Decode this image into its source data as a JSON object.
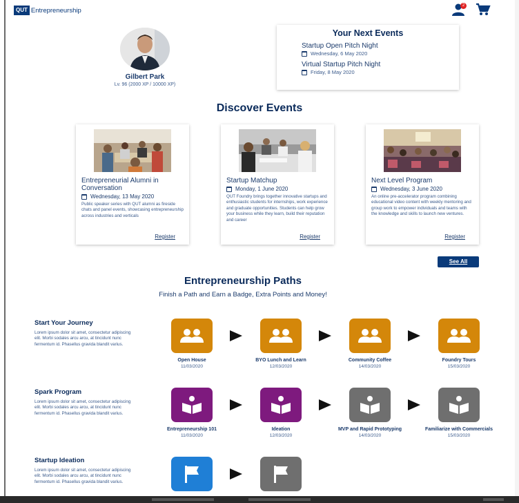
{
  "header": {
    "logo_mark": "QUT",
    "logo_text": "Entrepreneurship",
    "notification_count": "2"
  },
  "profile": {
    "name": "Gilbert Park",
    "level": "Lv. 96 (2000 XP / 10000 XP)"
  },
  "next_events": {
    "title": "Your Next Events",
    "items": [
      {
        "title": "Startup Open Pitch Night",
        "date": "Wednesday, 6 May 2020"
      },
      {
        "title": "Virtual Startup Pitch Night",
        "date": "Friday, 8 May 2020"
      }
    ]
  },
  "discover": {
    "title": "Discover Events",
    "see_all": "See All",
    "cards": [
      {
        "title": "Entrepreneurial Alumni in Conversation",
        "date": "Wednesday, 13 May 2020",
        "desc": "Public speaker series with QUT alumni as fireside chats and panel events, showcasing entrepreneurship across industries and verticals",
        "register": "Register"
      },
      {
        "title": "Startup Matchup",
        "date": "Monday, 1 June 2020",
        "desc": "QUT Foundry brings together innovative startups and enthusiastic students for internships, work experience and graduate opportunities. Students can help grow your business while they learn, build their reputation and career",
        "register": "Register"
      },
      {
        "title": "Next Level Program",
        "date": "Wednesday, 3 June 2020",
        "desc": "An online pre-accelerator program combining educational video content with weekly mentoring and group work to empower individuals and teams with the knowledge and skills to launch new ventures.",
        "register": "Register"
      }
    ]
  },
  "paths": {
    "title": "Entrepreneurship Paths",
    "subtitle": "Finish a Path and Earn a Badge, Extra Points and Money!",
    "rows": [
      {
        "title": "Start Your Journey",
        "desc": "Lorem ipsum dolor sit amet, consectetur adipiscing elit. Morbi sodales arcu arcu, at tincidunt nunc fermentum id. Phasellus gravida blandit varius.",
        "steps": [
          {
            "label": "Open House",
            "date": "11/03/2020",
            "icon": "group-icon",
            "color": "#d4870a"
          },
          {
            "label": "BYO Lunch and Learn",
            "date": "12/03/2020",
            "icon": "group-icon",
            "color": "#d4870a"
          },
          {
            "label": "Community Coffee",
            "date": "14/03/2020",
            "icon": "group-icon",
            "color": "#d4870a"
          },
          {
            "label": "Foundry Tours",
            "date": "15/03/2020",
            "icon": "group-icon",
            "color": "#d4870a"
          }
        ]
      },
      {
        "title": "Spark Program",
        "desc": "Lorem ipsum dolor sit amet, consectetur adipiscing elit. Morbi sodales arcu arcu, at tincidunt nunc fermentum id. Phasellus gravida blandit varius.",
        "steps": [
          {
            "label": "Entrepreneurship 101",
            "date": "11/03/2020",
            "icon": "book-icon",
            "color": "#7e1a7e"
          },
          {
            "label": "Ideation",
            "date": "12/03/2020",
            "icon": "book-icon",
            "color": "#7e1a7e"
          },
          {
            "label": "MVP and Rapid Prototyping",
            "date": "14/03/2020",
            "icon": "book-icon",
            "color": "#6f6f6f"
          },
          {
            "label": "Familiarize with Commercials",
            "date": "15/03/2020",
            "icon": "book-icon",
            "color": "#6f6f6f"
          }
        ]
      },
      {
        "title": "Startup Ideation",
        "desc": "Lorem ipsum dolor sit amet, consectetur adipiscing elit. Morbi sodales arcu arcu, at tincidunt nunc fermentum id. Phasellus gravida blandit varius.",
        "steps": [
          {
            "label": "",
            "date": "",
            "icon": "flag-icon",
            "color": "#1f7fd6"
          },
          {
            "label": "",
            "date": "",
            "icon": "flag-icon",
            "color": "#6f6f6f"
          }
        ]
      }
    ]
  }
}
